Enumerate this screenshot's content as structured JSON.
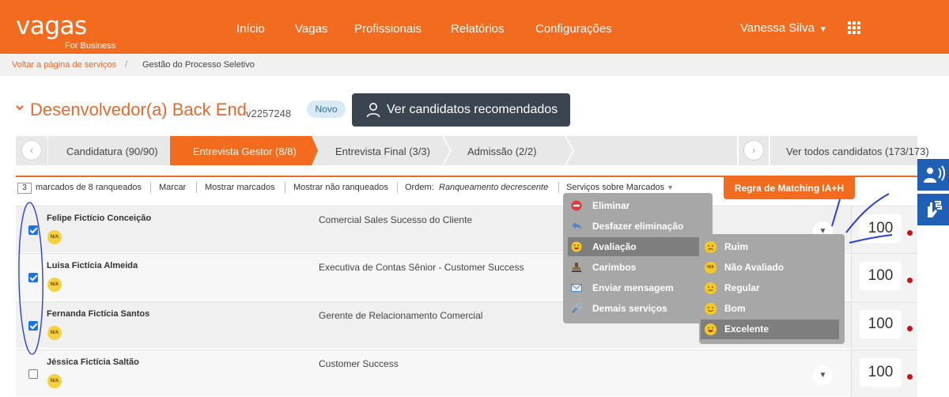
{
  "header": {
    "logo_word": "vagas",
    "logo_sub": "For Business",
    "nav": [
      "Início",
      "Vagas",
      "Profissionais",
      "Relatórios",
      "Configurações"
    ],
    "user_name": "Vanessa Silva",
    "apps_icon": "grid-icon",
    "brand_color": "#f26b1f"
  },
  "breadcrumb": {
    "back_link": "Voltar a página de serviços",
    "separator": "/",
    "current": "Gestão do Processo Seletivo"
  },
  "job": {
    "title": "Desenvolvedor(a) Back End",
    "code": "v2257248",
    "badge": "Novo",
    "recommend_button": "Ver candidatos recomendados"
  },
  "stages": {
    "items": [
      {
        "label": "Candidatura (90/90)",
        "active": false
      },
      {
        "label": "Entrevista Gestor (8/8)",
        "active": true
      },
      {
        "label": "Entrevista Final (3/3)",
        "active": false
      },
      {
        "label": "Admissão (2/2)",
        "active": false
      }
    ],
    "view_all": "Ver todos candidatos (173/173)",
    "prev_glyph": "‹",
    "next_glyph": "›"
  },
  "toolbar": {
    "count": "3",
    "marked_text": "marcados de 8 ranqueados",
    "mark": "Marcar",
    "show_marked": "Mostrar marcados",
    "show_unranked": "Mostrar não ranqueados",
    "order_label": "Ordem:",
    "order_value": "Ranqueamento decrescente",
    "services": "Serviços sobre Marcados",
    "matching_rule": "Regra de Matching IA+H"
  },
  "candidates": [
    {
      "name": "Felipe Fictício Conceição",
      "role": "Comercial Sales Sucesso do Cliente",
      "badge": "N/A",
      "score": "100",
      "checked": true
    },
    {
      "name": "Luisa Fictícia Almeida",
      "role": "Executiva de Contas Sênior - Customer Success",
      "badge": "N/A",
      "score": "100",
      "checked": true
    },
    {
      "name": "Fernanda Fictícia Santos",
      "role": "Gerente de Relacionamento Comercial",
      "badge": "N/A",
      "score": "100",
      "checked": true
    },
    {
      "name": "Jéssica Fictícia Saltão",
      "role": "Customer Success",
      "badge": "N/A",
      "score": "100",
      "checked": false
    }
  ],
  "services_menu": [
    {
      "label": "Eliminar",
      "icon": "block-icon"
    },
    {
      "label": "Desfazer eliminação",
      "icon": "undo-arrow-icon"
    },
    {
      "label": "Avaliação",
      "icon": "smiley-icon",
      "selected": true
    },
    {
      "label": "Carimbos",
      "icon": "stamp-icon"
    },
    {
      "label": "Enviar mensagem",
      "icon": "envelope-icon"
    },
    {
      "label": "Demais serviços",
      "icon": "wrench-icon"
    }
  ],
  "rating_menu": [
    {
      "label": "Ruim",
      "icon": "sad-face-icon"
    },
    {
      "label": "Não Avaliado",
      "icon": "na-badge-icon",
      "icon_text": "N/A"
    },
    {
      "label": "Regular",
      "icon": "neutral-face-icon"
    },
    {
      "label": "Bom",
      "icon": "smile-face-icon"
    },
    {
      "label": "Excelente",
      "icon": "grin-face-icon",
      "selected": true
    }
  ],
  "accessibility": [
    "sign-language-icon",
    "hands-icon"
  ]
}
